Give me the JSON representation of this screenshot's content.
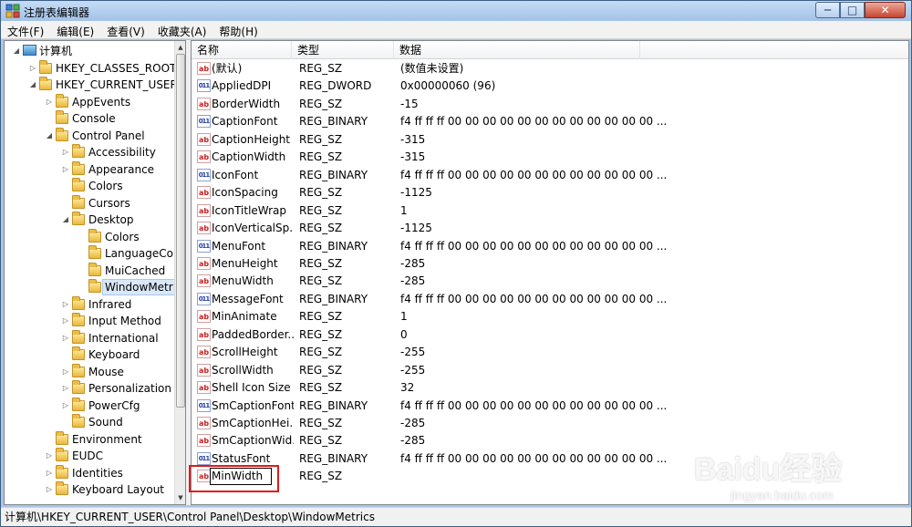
{
  "window": {
    "title": "注册表编辑器",
    "min": "─",
    "max": "□",
    "close": "✕"
  },
  "menu": [
    "文件(F)",
    "编辑(E)",
    "查看(V)",
    "收藏夹(A)",
    "帮助(H)"
  ],
  "tree": [
    {
      "label": "计算机",
      "arrow": "◢",
      "icon": "computer",
      "level": 0
    },
    {
      "label": "HKEY_CLASSES_ROOT",
      "arrow": "▷",
      "icon": "folder",
      "level": 1
    },
    {
      "label": "HKEY_CURRENT_USER",
      "arrow": "◢",
      "icon": "folder",
      "level": 1
    },
    {
      "label": "AppEvents",
      "arrow": "▷",
      "icon": "folder",
      "level": 2
    },
    {
      "label": "Console",
      "arrow": "",
      "icon": "folder",
      "level": 2
    },
    {
      "label": "Control Panel",
      "arrow": "◢",
      "icon": "folder",
      "level": 2
    },
    {
      "label": "Accessibility",
      "arrow": "▷",
      "icon": "folder",
      "level": 3
    },
    {
      "label": "Appearance",
      "arrow": "▷",
      "icon": "folder",
      "level": 3
    },
    {
      "label": "Colors",
      "arrow": "",
      "icon": "folder",
      "level": 3
    },
    {
      "label": "Cursors",
      "arrow": "",
      "icon": "folder",
      "level": 3
    },
    {
      "label": "Desktop",
      "arrow": "◢",
      "icon": "folder",
      "level": 3
    },
    {
      "label": "Colors",
      "arrow": "",
      "icon": "folder",
      "level": 4
    },
    {
      "label": "LanguageCor",
      "arrow": "",
      "icon": "folder",
      "level": 4
    },
    {
      "label": "MuiCached",
      "arrow": "",
      "icon": "folder",
      "level": 4
    },
    {
      "label": "WindowMetr",
      "arrow": "",
      "icon": "folder",
      "level": 4,
      "selected": true
    },
    {
      "label": "Infrared",
      "arrow": "▷",
      "icon": "folder",
      "level": 3
    },
    {
      "label": "Input Method",
      "arrow": "▷",
      "icon": "folder",
      "level": 3
    },
    {
      "label": "International",
      "arrow": "▷",
      "icon": "folder",
      "level": 3
    },
    {
      "label": "Keyboard",
      "arrow": "",
      "icon": "folder",
      "level": 3
    },
    {
      "label": "Mouse",
      "arrow": "▷",
      "icon": "folder",
      "level": 3
    },
    {
      "label": "Personalization",
      "arrow": "▷",
      "icon": "folder",
      "level": 3
    },
    {
      "label": "PowerCfg",
      "arrow": "▷",
      "icon": "folder",
      "level": 3
    },
    {
      "label": "Sound",
      "arrow": "",
      "icon": "folder",
      "level": 3
    },
    {
      "label": "Environment",
      "arrow": "",
      "icon": "folder",
      "level": 2
    },
    {
      "label": "EUDC",
      "arrow": "▷",
      "icon": "folder",
      "level": 2
    },
    {
      "label": "Identities",
      "arrow": "▷",
      "icon": "folder",
      "level": 2
    },
    {
      "label": "Keyboard Layout",
      "arrow": "▷",
      "icon": "folder",
      "level": 2
    }
  ],
  "list": {
    "columns": [
      "名称",
      "类型",
      "数据"
    ],
    "rows": [
      {
        "name": "(默认)",
        "type": "REG_SZ",
        "data": "(数值未设置)",
        "icon": "ab"
      },
      {
        "name": "AppliedDPI",
        "type": "REG_DWORD",
        "data": "0x00000060 (96)",
        "icon": "011"
      },
      {
        "name": "BorderWidth",
        "type": "REG_SZ",
        "data": "-15",
        "icon": "ab"
      },
      {
        "name": "CaptionFont",
        "type": "REG_BINARY",
        "data": "f4 ff ff ff 00 00 00 00 00 00 00 00 00 00 00 00 ...",
        "icon": "011"
      },
      {
        "name": "CaptionHeight",
        "type": "REG_SZ",
        "data": "-315",
        "icon": "ab"
      },
      {
        "name": "CaptionWidth",
        "type": "REG_SZ",
        "data": "-315",
        "icon": "ab"
      },
      {
        "name": "IconFont",
        "type": "REG_BINARY",
        "data": "f4 ff ff ff 00 00 00 00 00 00 00 00 00 00 00 00 ...",
        "icon": "011"
      },
      {
        "name": "IconSpacing",
        "type": "REG_SZ",
        "data": "-1125",
        "icon": "ab"
      },
      {
        "name": "IconTitleWrap",
        "type": "REG_SZ",
        "data": "1",
        "icon": "ab"
      },
      {
        "name": "IconVerticalSp...",
        "type": "REG_SZ",
        "data": "-1125",
        "icon": "ab"
      },
      {
        "name": "MenuFont",
        "type": "REG_BINARY",
        "data": "f4 ff ff ff 00 00 00 00 00 00 00 00 00 00 00 00 ...",
        "icon": "011"
      },
      {
        "name": "MenuHeight",
        "type": "REG_SZ",
        "data": "-285",
        "icon": "ab"
      },
      {
        "name": "MenuWidth",
        "type": "REG_SZ",
        "data": "-285",
        "icon": "ab"
      },
      {
        "name": "MessageFont",
        "type": "REG_BINARY",
        "data": "f4 ff ff ff 00 00 00 00 00 00 00 00 00 00 00 00 ...",
        "icon": "011"
      },
      {
        "name": "MinAnimate",
        "type": "REG_SZ",
        "data": "1",
        "icon": "ab"
      },
      {
        "name": "PaddedBorder...",
        "type": "REG_SZ",
        "data": "0",
        "icon": "ab"
      },
      {
        "name": "ScrollHeight",
        "type": "REG_SZ",
        "data": "-255",
        "icon": "ab"
      },
      {
        "name": "ScrollWidth",
        "type": "REG_SZ",
        "data": "-255",
        "icon": "ab"
      },
      {
        "name": "Shell Icon Size",
        "type": "REG_SZ",
        "data": "32",
        "icon": "ab"
      },
      {
        "name": "SmCaptionFont",
        "type": "REG_BINARY",
        "data": "f4 ff ff ff 00 00 00 00 00 00 00 00 00 00 00 00 ...",
        "icon": "011"
      },
      {
        "name": "SmCaptionHei...",
        "type": "REG_SZ",
        "data": "-285",
        "icon": "ab"
      },
      {
        "name": "SmCaptionWid...",
        "type": "REG_SZ",
        "data": "-285",
        "icon": "ab"
      },
      {
        "name": "StatusFont",
        "type": "REG_BINARY",
        "data": "f4 ff ff ff 00 00 00 00 00 00 00 00 00 00 00 00 ...",
        "icon": "011"
      },
      {
        "name": "MinWidth",
        "type": "REG_SZ",
        "data": "",
        "icon": "ab",
        "editing": true
      }
    ]
  },
  "status": {
    "path": "计算机\\HKEY_CURRENT_USER\\Control Panel\\Desktop\\WindowMetrics"
  },
  "watermark": {
    "brand": "Baidu经验",
    "url": "jingyan.baidu.com"
  },
  "colors": {
    "highlight": "#e01919",
    "selection": "#d9e8f7"
  }
}
